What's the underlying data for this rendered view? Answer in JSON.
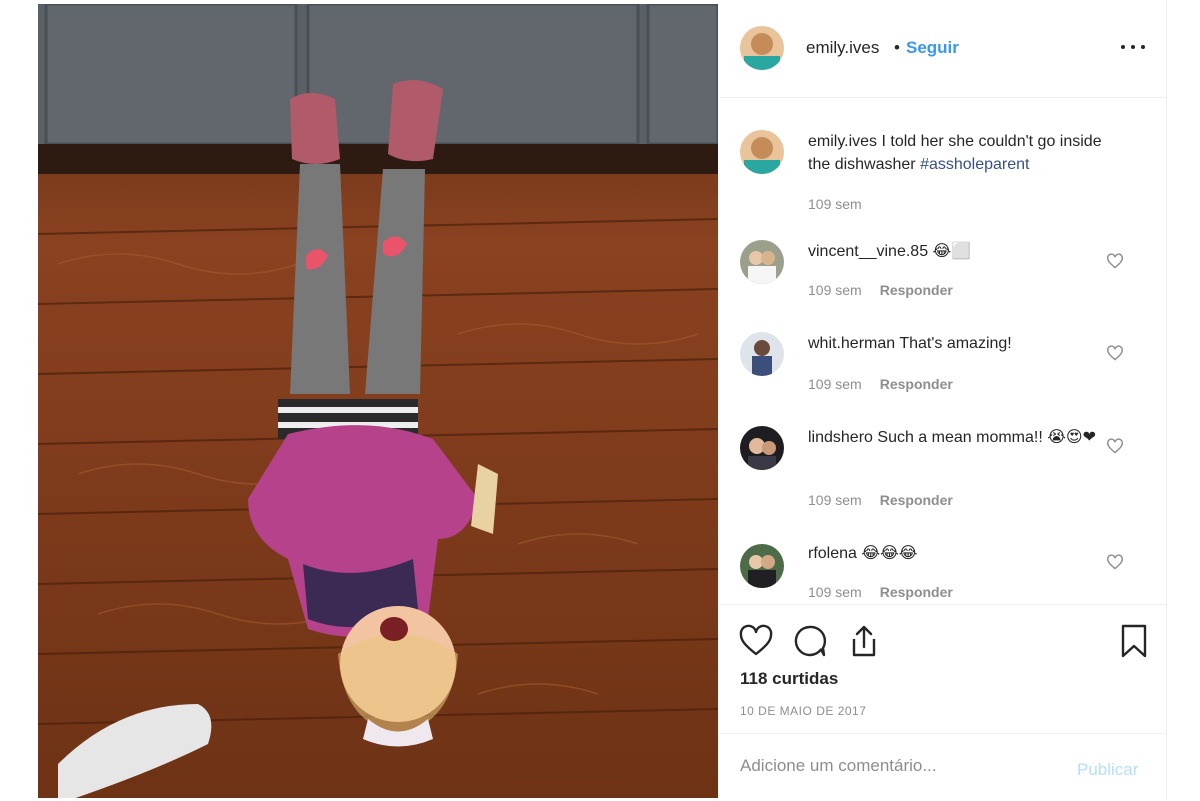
{
  "post": {
    "username": "emily.ives",
    "separator": "•",
    "follow_label": "Seguir",
    "more_icon": "more-options-icon"
  },
  "caption": {
    "username": "emily.ives",
    "text": "I told her she couldn't go inside the dishwasher",
    "hashtag": "#assholeparent",
    "time": "109 sem"
  },
  "comments": [
    {
      "username": "vincent__vine.85",
      "text": "😂⬜",
      "time": "109 sem",
      "reply_label": "Responder"
    },
    {
      "username": "whit.herman",
      "text": "That's amazing!",
      "time": "109 sem",
      "reply_label": "Responder"
    },
    {
      "username": "lindshero",
      "text": "Such a mean momma!! 😭😍❤",
      "time": "109 sem",
      "reply_label": "Responder"
    },
    {
      "username": "rfolena",
      "text": "😂😂😂",
      "time": "109 sem",
      "reply_label": "Responder"
    }
  ],
  "actions": {
    "like_icon": "heart-icon",
    "comment_icon": "comment-icon",
    "share_icon": "share-icon",
    "save_icon": "bookmark-icon",
    "likes_text": "118 curtidas",
    "date_text": "10 DE MAIO DE 2017"
  },
  "add_comment": {
    "placeholder": "Adicione um comentário...",
    "publish_label": "Publicar"
  },
  "colors": {
    "link_blue": "#3897f0",
    "publish_disabled": "#b2dffc",
    "text": "#262626",
    "muted": "#8e8e8e",
    "border": "#efefef"
  }
}
